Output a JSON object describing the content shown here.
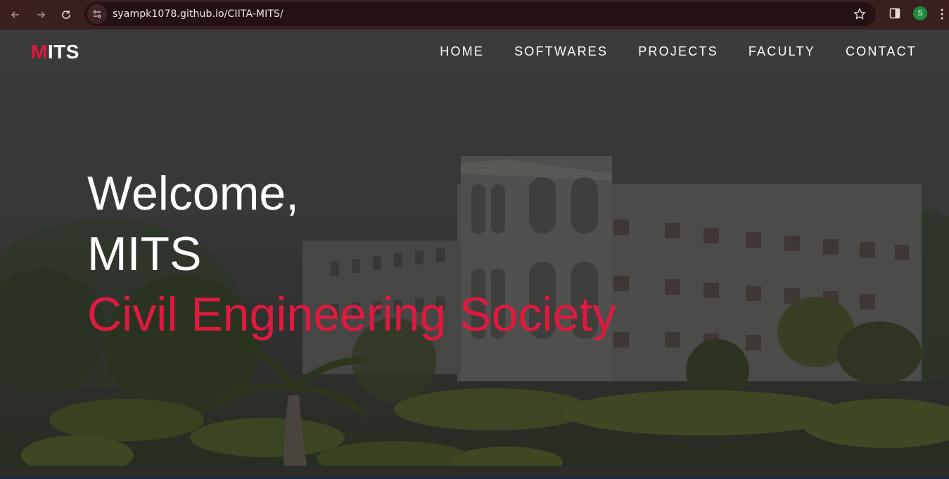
{
  "browser": {
    "url": "syampk1078.github.io/CIITA-MITS/",
    "avatar_letter": "S",
    "icons": [
      "back-icon",
      "forward-icon",
      "reload-icon",
      "site-info-icon",
      "star-icon",
      "side-panel-icon",
      "kebab-menu-icon"
    ]
  },
  "navbar": {
    "logo_m": "M",
    "logo_rest": "ITS",
    "items": [
      "HOME",
      "SOFTWARES",
      "PROJECTS",
      "FACULTY",
      "CONTACT"
    ]
  },
  "hero": {
    "line1": "Welcome,",
    "line2": "MITS",
    "line3": "Civil Engineering Society"
  },
  "colors": {
    "accent": "#e0193f",
    "chrome_bg": "#3a1f1f",
    "navbar_bg": "#3c3c3c"
  }
}
